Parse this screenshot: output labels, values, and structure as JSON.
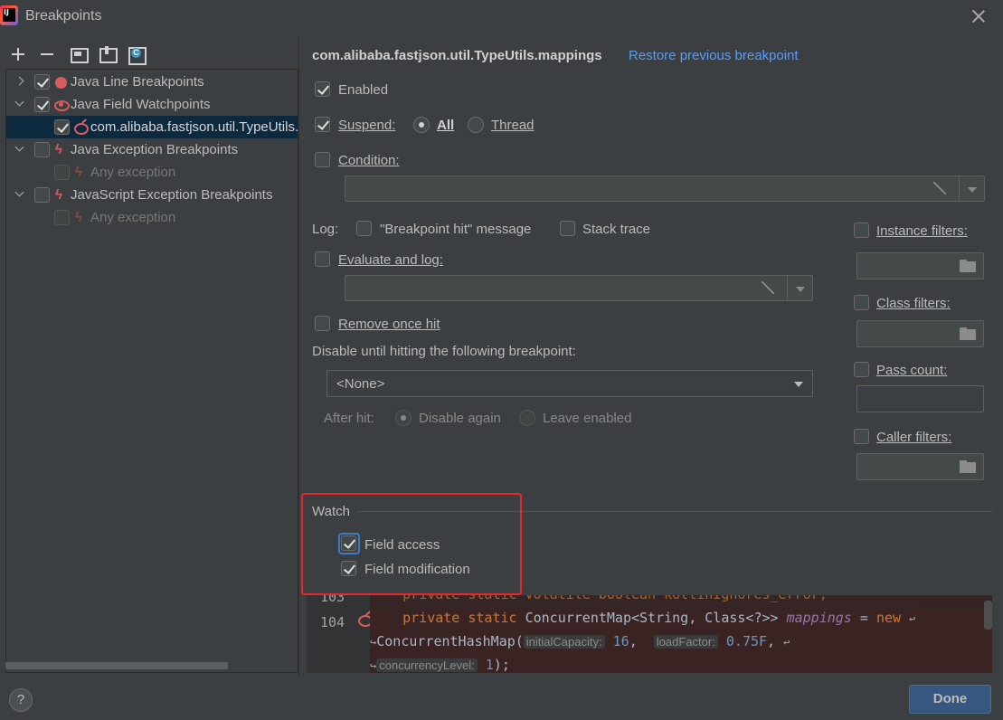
{
  "window": {
    "title": "Breakpoints"
  },
  "toolbar": {
    "icons": [
      "plus-icon",
      "minus-icon",
      "folder-icon",
      "package-icon",
      "class-icon"
    ]
  },
  "tree": {
    "items": [
      {
        "label": "Java Line Breakpoints",
        "checked": true,
        "expanded": false,
        "icon": "red-dot-icon"
      },
      {
        "label": "Java Field Watchpoints",
        "checked": true,
        "expanded": true,
        "icon": "eye-icon"
      },
      {
        "label": "com.alibaba.fastjson.util.TypeUtils.mappings",
        "checked": true,
        "selected": true,
        "icon": "field-watch-icon"
      },
      {
        "label": "Java Exception Breakpoints",
        "checked": false,
        "expanded": true,
        "icon": "lightning-icon"
      },
      {
        "label": "Any exception",
        "checked": false,
        "disabled": true,
        "icon": "lightning-icon"
      },
      {
        "label": "JavaScript Exception Breakpoints",
        "checked": false,
        "expanded": true,
        "icon": "lightning-icon"
      },
      {
        "label": "Any exception",
        "checked": false,
        "disabled": true,
        "icon": "lightning-icon"
      }
    ]
  },
  "details": {
    "breakpoint_name": "com.alibaba.fastjson.util.TypeUtils.mappings",
    "restore_link": "Restore previous breakpoint",
    "enabled_label": "Enabled",
    "suspend_label": "Suspend:",
    "suspend_all": "All",
    "suspend_thread": "Thread",
    "condition_label": "Condition:",
    "log_label": "Log:",
    "log_message": "\"Breakpoint hit\" message",
    "log_stack": "Stack trace",
    "evaluate_label": "Evaluate and log:",
    "remove_once_hit": "Remove once hit",
    "disable_until": "Disable until hitting the following breakpoint:",
    "disable_until_value": "<None>",
    "after_hit": "After hit:",
    "disable_again": "Disable again",
    "leave_enabled": "Leave enabled",
    "instance_filters": "Instance filters:",
    "class_filters": "Class filters:",
    "pass_count": "Pass count:",
    "caller_filters": "Caller filters:"
  },
  "watch": {
    "title": "Watch",
    "field_access": "Field access",
    "field_modification": "Field modification",
    "field_access_checked": true,
    "field_modification_checked": true
  },
  "editor": {
    "line_prev_num": "103",
    "line_prev": "    private static volatile boolean kotlinIgnores_error;",
    "line_num": "104",
    "kw_private": "private",
    "kw_static": "static",
    "type": "ConcurrentMap<String, Class<?>>",
    "field": "mappings",
    "eq": "=",
    "kw_new": "new",
    "cont_class": "ConcurrentHashMap(",
    "hint_cap": "initialCapacity:",
    "val_cap": "16",
    "hint_load": "loadFactor:",
    "val_load": "0.75F",
    "hint_conc": "concurrencyLevel:",
    "val_conc": "1",
    "tail": ");"
  },
  "footer": {
    "help": "?",
    "done": "Done"
  }
}
